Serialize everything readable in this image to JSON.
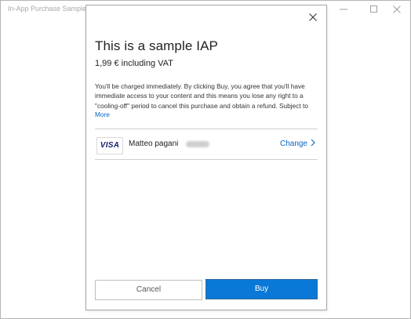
{
  "window": {
    "title": "In-App Purchase Sample"
  },
  "dialog": {
    "product_title": "This is a sample IAP",
    "price": "1,99 € including VAT",
    "disclaimer_lines": [
      "You'll be charged immediately. By clicking Buy, you agree that you'll have",
      "immediate access to your content and this means you lose any right to a",
      "\"cooling-off\" period to cancel this purchase and obtain a refund. Subject to"
    ],
    "more_label": "More",
    "payment": {
      "card_brand": "VISA",
      "card_holder": "Matteo pagani",
      "change_label": "Change"
    },
    "cancel_label": "Cancel",
    "buy_label": "Buy"
  },
  "colors": {
    "accent": "#0a78d7",
    "link": "#0a64c8",
    "visa_blue": "#1a1f71"
  },
  "icons": {
    "minimize": "minimize-icon",
    "maximize": "maximize-icon",
    "close": "close-icon",
    "chevron": "chevron-right-icon"
  }
}
